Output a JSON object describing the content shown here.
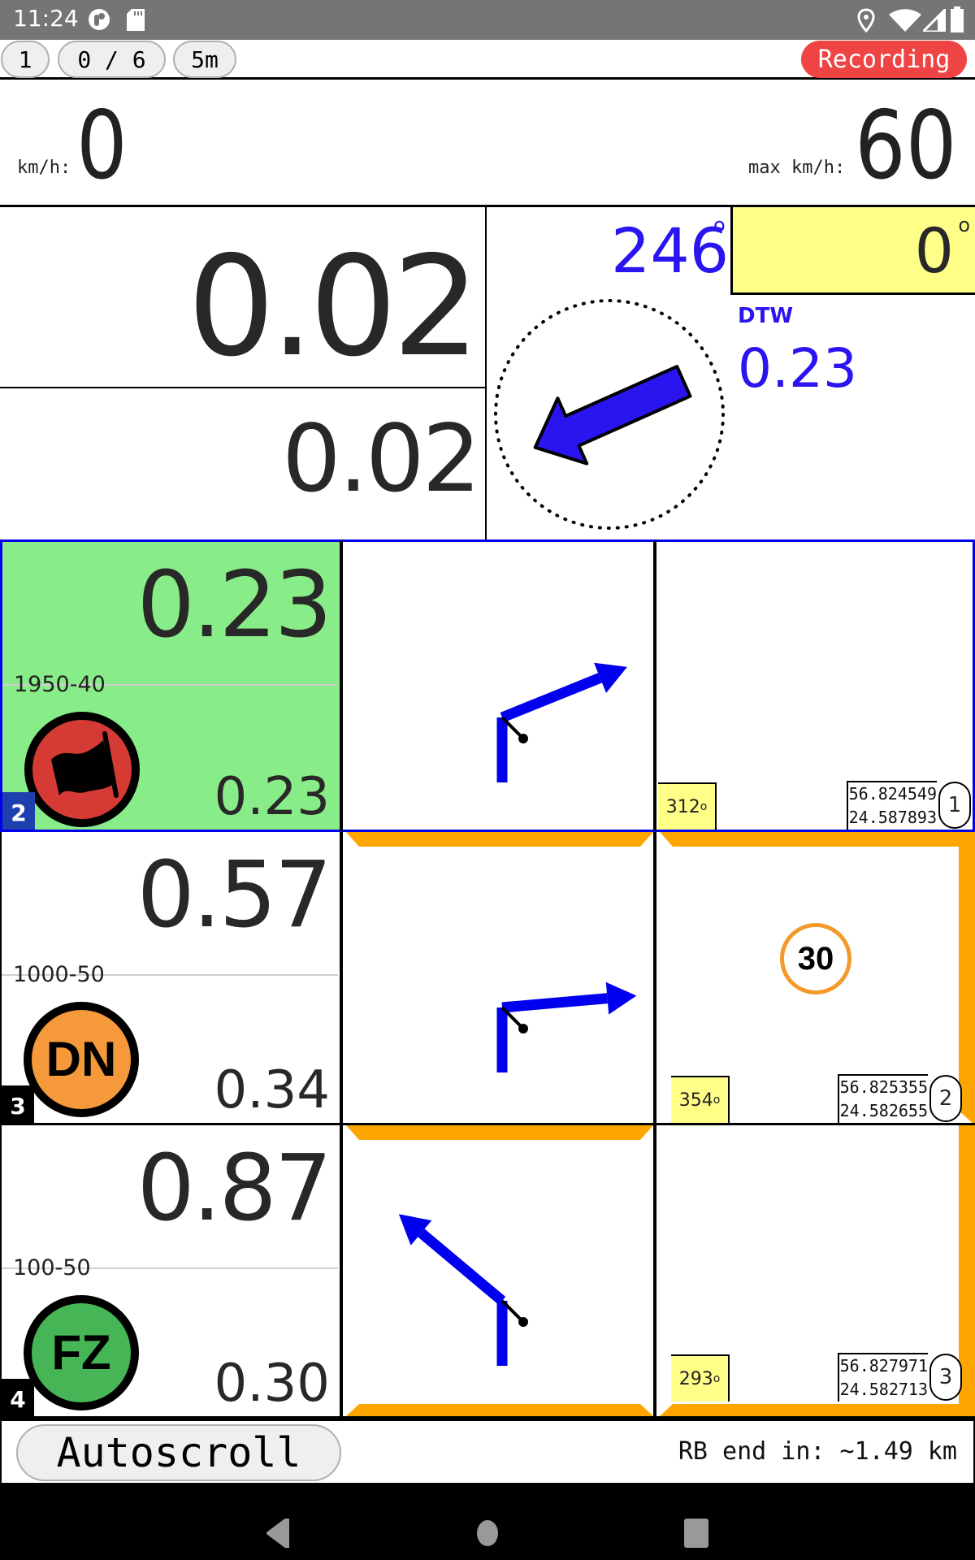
{
  "status_bar": {
    "time": "11:24",
    "left_icons": [
      "app-notification-icon",
      "sd-card-icon"
    ],
    "right_icons": [
      "location-icon",
      "wifi-icon",
      "cell-signal-icon",
      "battery-icon"
    ]
  },
  "toolbar": {
    "page_button": "1",
    "counter_button": "0 / 6",
    "interval_button": "5m",
    "recording_badge": "Recording",
    "recording_color": "#ef4444"
  },
  "speed": {
    "unit_label": "km/h:",
    "value": "0",
    "max_label": "max km/h:",
    "max_value": "60"
  },
  "distance": {
    "primary": "0.02",
    "secondary": "0.02"
  },
  "compass": {
    "heading": "246",
    "heading_unit": "o",
    "heading_color": "#2a14f0",
    "deviation": "0",
    "deviation_unit": "o",
    "dtw_label": "DTW",
    "dtw_value": "0.23",
    "arrow_bearing_deg": 246
  },
  "waypoints": [
    {
      "index": "2",
      "distance": "0.23",
      "range": "1950-40",
      "sub_distance": "0.23",
      "icon": "flag-icon",
      "icon_color": "#d63a35",
      "highlight": true,
      "bearing": "312",
      "bearing_unit": "o",
      "lat": "56.824549",
      "lon": "24.587893",
      "wp_number": "1",
      "turn": "right-slight",
      "sign": null
    },
    {
      "index": "3",
      "distance": "0.57",
      "range": "1000-50",
      "sub_distance": "0.34",
      "icon": "dn-badge-icon",
      "icon_text": "DN",
      "icon_color": "#f5993a",
      "highlight": false,
      "bearing": "354",
      "bearing_unit": "o",
      "lat": "56.825355",
      "lon": "24.582655",
      "wp_number": "2",
      "turn": "right",
      "sign": "30"
    },
    {
      "index": "4",
      "distance": "0.87",
      "range": "100-50",
      "sub_distance": "0.30",
      "icon": "fz-badge-icon",
      "icon_text": "FZ",
      "icon_color": "#45b555",
      "highlight": false,
      "bearing": "293",
      "bearing_unit": "o",
      "lat": "56.827971",
      "lon": "24.582713",
      "wp_number": "3",
      "turn": "left-slight",
      "sign": null
    }
  ],
  "bottom": {
    "autoscroll_label": "Autoscroll",
    "rb_end": "RB end in: ~1.49 km"
  },
  "nav_bar": {
    "icons": [
      "back-icon",
      "home-icon",
      "recents-icon"
    ]
  }
}
